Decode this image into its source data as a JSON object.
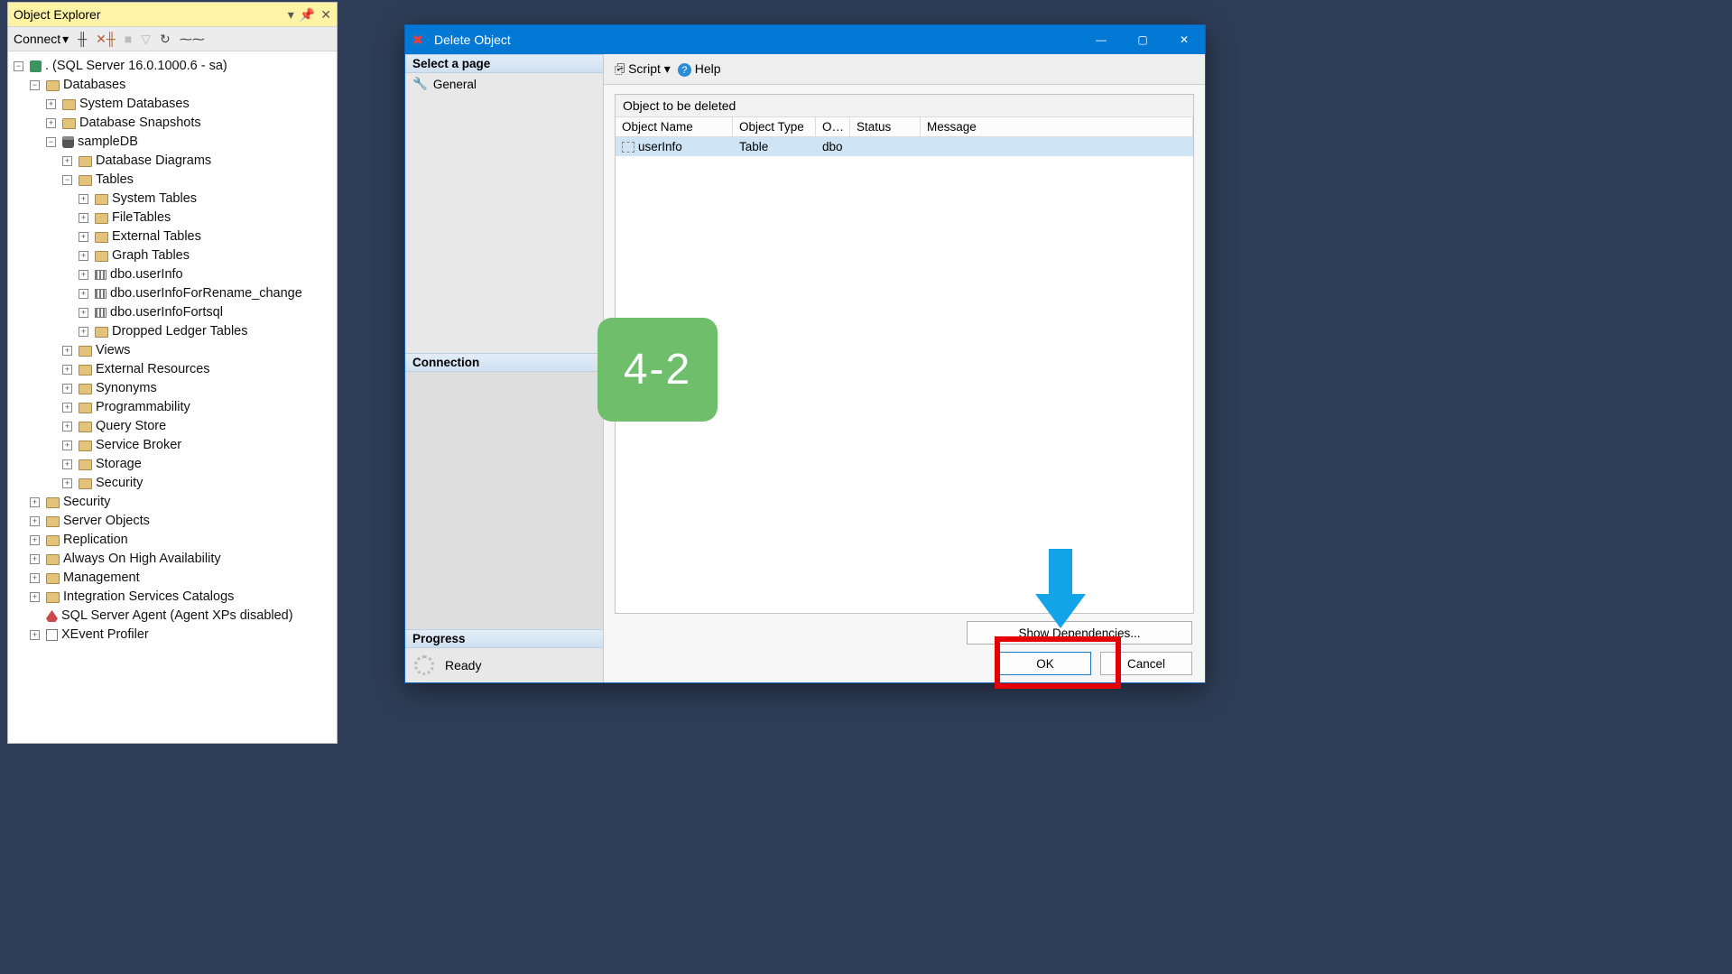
{
  "explorer": {
    "title": "Object Explorer",
    "connect_label": "Connect",
    "server_node": ". (SQL Server 16.0.1000.6 - sa)",
    "databases": "Databases",
    "system_databases": "System Databases",
    "db_snapshots": "Database Snapshots",
    "sampledb": "sampleDB",
    "db_diagrams": "Database Diagrams",
    "tables": "Tables",
    "system_tables": "System Tables",
    "file_tables": "FileTables",
    "external_tables": "External Tables",
    "graph_tables": "Graph Tables",
    "tbl_userinfo": "dbo.userInfo",
    "tbl_userinfo_rename": "dbo.userInfoForRename_change",
    "tbl_userinfo_fortsql": "dbo.userInfoFortsql",
    "dropped_ledger": "Dropped Ledger Tables",
    "views": "Views",
    "external_resources": "External Resources",
    "synonyms": "Synonyms",
    "programmability": "Programmability",
    "query_store": "Query Store",
    "service_broker": "Service Broker",
    "storage": "Storage",
    "security_db": "Security",
    "security": "Security",
    "server_objects": "Server Objects",
    "replication": "Replication",
    "always_on": "Always On High Availability",
    "management": "Management",
    "isc": "Integration Services Catalogs",
    "agent": "SQL Server Agent (Agent XPs disabled)",
    "xevent": "XEvent Profiler"
  },
  "dialog": {
    "title": "Delete Object",
    "select_page": "Select a page",
    "general": "General",
    "connection": "Connection",
    "progress": "Progress",
    "ready": "Ready",
    "script": "Script",
    "help": "Help",
    "group_title": "Object to be deleted",
    "col_name": "Object Name",
    "col_type": "Object Type",
    "col_owner": "O…",
    "col_status": "Status",
    "col_message": "Message",
    "row_name": "userInfo",
    "row_type": "Table",
    "row_owner": "dbo",
    "show_deps": "Show Dependencies...",
    "ok": "OK",
    "cancel": "Cancel"
  },
  "annotation": {
    "label": "4-2"
  }
}
